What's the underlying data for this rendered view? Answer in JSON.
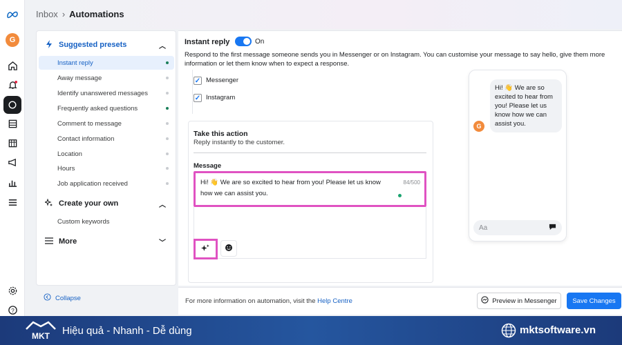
{
  "breadcrumb": {
    "parent": "Inbox",
    "current": "Automations"
  },
  "rail": {
    "avatar_letter": "G"
  },
  "sidebar": {
    "suggested": {
      "title": "Suggested presets",
      "items": [
        {
          "label": "Instant reply",
          "enabled": true
        },
        {
          "label": "Away message",
          "enabled": false
        },
        {
          "label": "Identify unanswered messages",
          "enabled": false
        },
        {
          "label": "Frequently asked questions",
          "enabled": true
        },
        {
          "label": "Comment to message",
          "enabled": false
        },
        {
          "label": "Contact information",
          "enabled": false
        },
        {
          "label": "Location",
          "enabled": false
        },
        {
          "label": "Hours",
          "enabled": false
        },
        {
          "label": "Job application received",
          "enabled": false
        }
      ]
    },
    "create": {
      "title": "Create your own",
      "items": [
        {
          "label": "Custom keywords"
        }
      ]
    },
    "more": {
      "title": "More"
    },
    "collapse_label": "Collapse"
  },
  "main": {
    "title": "Instant reply",
    "toggle_label": "On",
    "description": "Respond to the first message someone sends you in Messenger or on Instagram. You can customise your message to say hello, give them more information or let them know when to expect a response.",
    "channels": [
      "Messenger",
      "Instagram"
    ],
    "action": {
      "title": "Take this action",
      "subtitle": "Reply instantly to the customer.",
      "message_label": "Message",
      "message_text": "Hi! 👋 We are so excited to hear from you! Please let us know how we can assist you.",
      "char_count": "84/500"
    },
    "preview": {
      "bubble_text": "Hi! 👋 We are so excited to hear from you! Please let us know how we can assist you.",
      "avatar_letter": "G",
      "composer_placeholder": "Aa"
    }
  },
  "footer": {
    "info_text": "For more information on automation, visit the ",
    "help_link": "Help Centre",
    "preview_button": "Preview in Messenger",
    "save_button": "Save Changes"
  },
  "banner": {
    "slogan": "Hiệu quả - Nhanh - Dễ dùng",
    "site": "mktsoftware.vn",
    "logo_text": "MKT"
  },
  "colors": {
    "accent": "#1877f2",
    "highlight": "#e052c2",
    "banner": "#25569f"
  }
}
